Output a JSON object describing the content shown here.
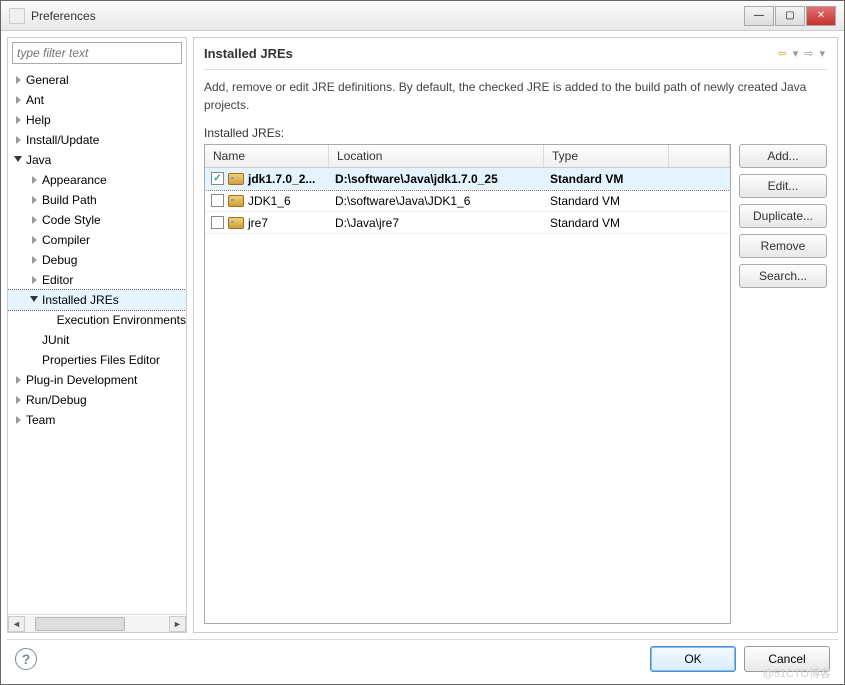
{
  "window": {
    "title": "Preferences"
  },
  "filter": {
    "placeholder": "type filter text"
  },
  "tree": {
    "items": [
      {
        "label": "General",
        "depth": 0,
        "expanded": false,
        "hasChildren": true
      },
      {
        "label": "Ant",
        "depth": 0,
        "expanded": false,
        "hasChildren": true
      },
      {
        "label": "Help",
        "depth": 0,
        "expanded": false,
        "hasChildren": true
      },
      {
        "label": "Install/Update",
        "depth": 0,
        "expanded": false,
        "hasChildren": true
      },
      {
        "label": "Java",
        "depth": 0,
        "expanded": true,
        "hasChildren": true
      },
      {
        "label": "Appearance",
        "depth": 1,
        "expanded": false,
        "hasChildren": true
      },
      {
        "label": "Build Path",
        "depth": 1,
        "expanded": false,
        "hasChildren": true
      },
      {
        "label": "Code Style",
        "depth": 1,
        "expanded": false,
        "hasChildren": true
      },
      {
        "label": "Compiler",
        "depth": 1,
        "expanded": false,
        "hasChildren": true
      },
      {
        "label": "Debug",
        "depth": 1,
        "expanded": false,
        "hasChildren": true
      },
      {
        "label": "Editor",
        "depth": 1,
        "expanded": false,
        "hasChildren": true
      },
      {
        "label": "Installed JREs",
        "depth": 1,
        "expanded": true,
        "hasChildren": true,
        "selected": true
      },
      {
        "label": "Execution Environments",
        "depth": 2,
        "expanded": false,
        "hasChildren": false
      },
      {
        "label": "JUnit",
        "depth": 1,
        "expanded": false,
        "hasChildren": false
      },
      {
        "label": "Properties Files Editor",
        "depth": 1,
        "expanded": false,
        "hasChildren": false
      },
      {
        "label": "Plug-in Development",
        "depth": 0,
        "expanded": false,
        "hasChildren": true
      },
      {
        "label": "Run/Debug",
        "depth": 0,
        "expanded": false,
        "hasChildren": true
      },
      {
        "label": "Team",
        "depth": 0,
        "expanded": false,
        "hasChildren": true
      }
    ]
  },
  "page": {
    "title": "Installed JREs",
    "description": "Add, remove or edit JRE definitions. By default, the checked JRE is added to the build path of newly created Java projects.",
    "table_label": "Installed JREs:"
  },
  "columns": {
    "name": "Name",
    "location": "Location",
    "type": "Type"
  },
  "jres": [
    {
      "checked": true,
      "selected": true,
      "name": "jdk1.7.0_2...",
      "location": "D:\\software\\Java\\jdk1.7.0_25",
      "type": "Standard VM"
    },
    {
      "checked": false,
      "selected": false,
      "name": "JDK1_6",
      "location": "D:\\software\\Java\\JDK1_6",
      "type": "Standard VM"
    },
    {
      "checked": false,
      "selected": false,
      "name": "jre7",
      "location": "D:\\Java\\jre7",
      "type": "Standard VM"
    }
  ],
  "buttons": {
    "add": "Add...",
    "edit": "Edit...",
    "duplicate": "Duplicate...",
    "remove": "Remove",
    "search": "Search..."
  },
  "footer": {
    "ok": "OK",
    "cancel": "Cancel"
  },
  "watermark": "@51CTO博客"
}
